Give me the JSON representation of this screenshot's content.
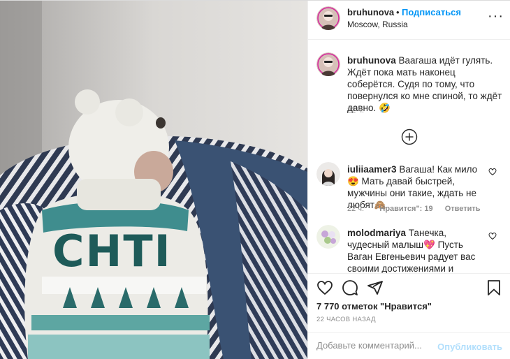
{
  "header": {
    "username": "bruhunova",
    "separator": "•",
    "follow_label": "Подписаться",
    "location": "Moscow, Russia",
    "more_label": "···"
  },
  "caption": {
    "username": "bruhunova",
    "text": "Ваагаша идёт гулять. Ждёт пока мать наконец соберётся. Судя по тому, что повернулся ко мне спиной, то ждёт давно. 🤣",
    "time": "22 ч."
  },
  "comments": [
    {
      "username": "iuliiaamer3",
      "text": "Вагаша! Как мило😍 Мать давай быстрей, мужчины они такие, ждать не любят🙈",
      "time": "22 ч.",
      "likes": "\"Нравится\": 19",
      "reply_label": "Ответить"
    },
    {
      "username": "molodmariya",
      "text": "Танечка, чудесный малыш💖 Пусть Ваган Евгеньевич радует вас своими достижениями и успехами😍"
    }
  ],
  "actions": {
    "likes_text": "7 770 отметок \"Нравится\"",
    "posted": "22 ЧАСОВ НАЗАД"
  },
  "add_comment": {
    "placeholder": "Добавьте комментарий...",
    "publish_label": "Опубликовать"
  },
  "icons": [
    "heart-icon",
    "comment-icon",
    "share-icon",
    "bookmark-icon",
    "plus-circle-icon",
    "more-icon"
  ],
  "colors": {
    "link": "#0095f6",
    "muted": "#8e8e8e",
    "publish_disabled": "#b2dffc"
  }
}
